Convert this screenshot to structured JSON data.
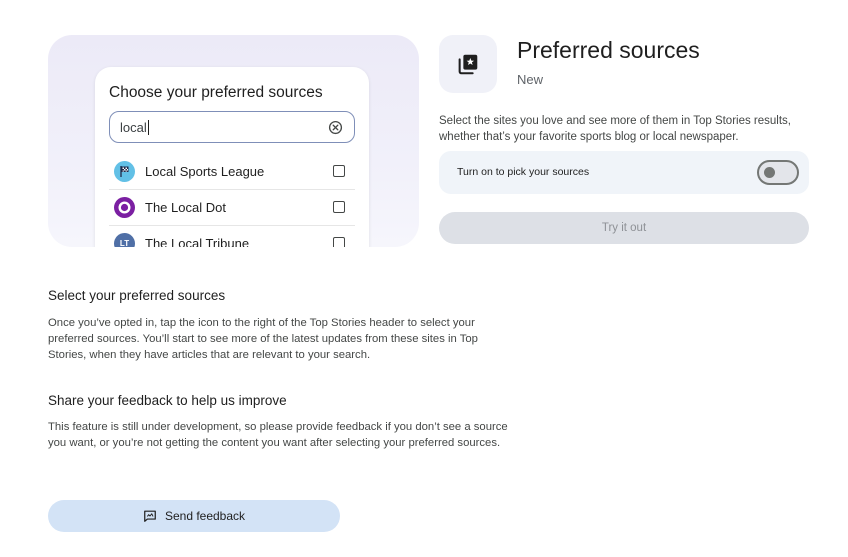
{
  "chooser": {
    "title": "Choose your preferred sources",
    "search_value": "local",
    "sources": [
      {
        "name": "Local Sports League"
      },
      {
        "name": "The Local Dot"
      },
      {
        "name": "The Local Tribune",
        "logo_text": "LT"
      }
    ]
  },
  "feature": {
    "title": "Preferred sources",
    "badge": "New",
    "description": "Select the sites you love and see more of them in Top Stories results, whether that’s your favorite sports blog or local newspaper.",
    "toggle_label": "Turn on to pick your sources",
    "toggle_on": false,
    "try_label": "Try it out"
  },
  "sections": [
    {
      "title": "Select your preferred sources",
      "body": "Once you’ve opted in, tap the icon to the right of the Top Stories header to select your preferred sources. You’ll start to see more of the latest updates from these sites in Top Stories, when they have articles that are relevant to your search."
    },
    {
      "title": "Share your feedback to help us improve",
      "body": "This feature is still under development, so please provide feedback if you don’t see a source you want, or you’re not getting the content you want after selecting your preferred sources."
    }
  ],
  "feedback": {
    "label": "Send feedback"
  },
  "colors": {
    "accent_blue": "#d3e3f6",
    "search_border": "#7f8fb8",
    "disabled_button": "#dde0e6"
  }
}
